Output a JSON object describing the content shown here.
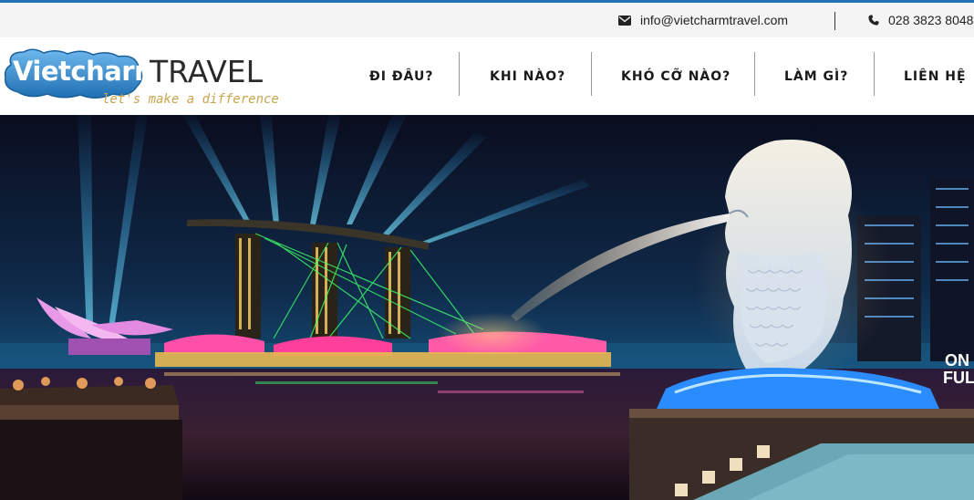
{
  "topbar": {
    "email": "info@vietcharmtravel.com",
    "phone": "028 3823 8048",
    "email_icon": "envelope-icon",
    "phone_icon": "phone-icon"
  },
  "logo": {
    "name": "Vietcharm",
    "travel": "TRAVEL",
    "tagline": "let's make a difference"
  },
  "nav": {
    "items": [
      {
        "label": "ĐI ĐÂU?"
      },
      {
        "label": "KHI NÀO?"
      },
      {
        "label": "KHÓ CỠ NÀO?"
      },
      {
        "label": "LÀM GÌ?"
      },
      {
        "label": "LIÊN HỆ"
      }
    ]
  },
  "hero": {
    "sign_text_1": "ON",
    "sign_text_2": "FUL"
  },
  "colors": {
    "accent": "#1f6fb2",
    "tagline": "#c9a550",
    "logo_bubble": "#3b8fd4"
  }
}
